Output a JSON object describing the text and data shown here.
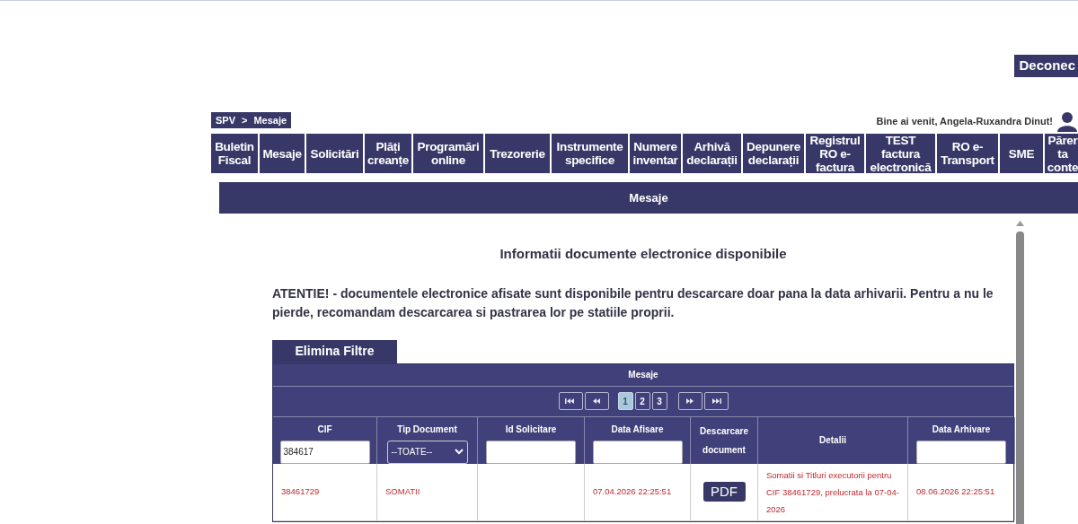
{
  "logout_button": "Deconec",
  "breadcrumb": [
    "SPV",
    ">",
    "Mesaje"
  ],
  "welcome": "Bine ai venit, Angela-Ruxandra Dinut!",
  "nav": [
    {
      "label": "Buletin Fiscal"
    },
    {
      "label": "Mesaje"
    },
    {
      "label": "Solicitări"
    },
    {
      "label": "Plăți creanțe"
    },
    {
      "label": "Programări online"
    },
    {
      "label": "Trezorerie"
    },
    {
      "label": "Instrumente specifice"
    },
    {
      "label": "Numere inventar"
    },
    {
      "label": "Arhivă declarații"
    },
    {
      "label": "Depunere declarații"
    },
    {
      "label": "Registrul RO e-factura"
    },
    {
      "label": "TEST factura electronică"
    },
    {
      "label": "RO e-Transport"
    },
    {
      "label": "SME"
    },
    {
      "label": "Părer ta conte"
    }
  ],
  "section_title": "Mesaje",
  "heading": "Informatii documente electronice disponibile",
  "notice": "ATENTIE! - documentele electronice afisate sunt disponibile pentru descarcare doar pana la data arhivarii. Pentru a nu le pierde, recomandam descarcarea si pastrarea lor pe statiile proprii.",
  "clear_filters_button": "Elimina Filtre",
  "table": {
    "title": "Mesaje",
    "pager": {
      "pages": [
        {
          "label": "1",
          "selected": true
        },
        {
          "label": "2",
          "selected": false
        },
        {
          "label": "3",
          "selected": false
        }
      ]
    },
    "columns": [
      {
        "label": "CIF",
        "filter": {
          "kind": "text",
          "value": "384617"
        }
      },
      {
        "label": "Tip Document",
        "filter": {
          "kind": "select",
          "value": "--TOATE--"
        }
      },
      {
        "label": "Id Solicitare",
        "filter": {
          "kind": "text"
        }
      },
      {
        "label": "Data Afisare",
        "filter": {
          "kind": "text"
        }
      },
      {
        "label": "Descarcare document"
      },
      {
        "label": "Detalii"
      },
      {
        "label": "Data Arhivare",
        "filter": {
          "kind": "text"
        }
      }
    ],
    "rows": [
      {
        "cif": "38461729",
        "tip": "SOMATII",
        "id": "",
        "data_afisare": "07.04.2026 22:25:51",
        "download": "PDF",
        "detalii": "Somatii si Titluri executorii pentru CIF 38461729, prelucrata la 07-04-2026",
        "data_arhivare": "08.06.2026 22:25:51"
      }
    ]
  }
}
